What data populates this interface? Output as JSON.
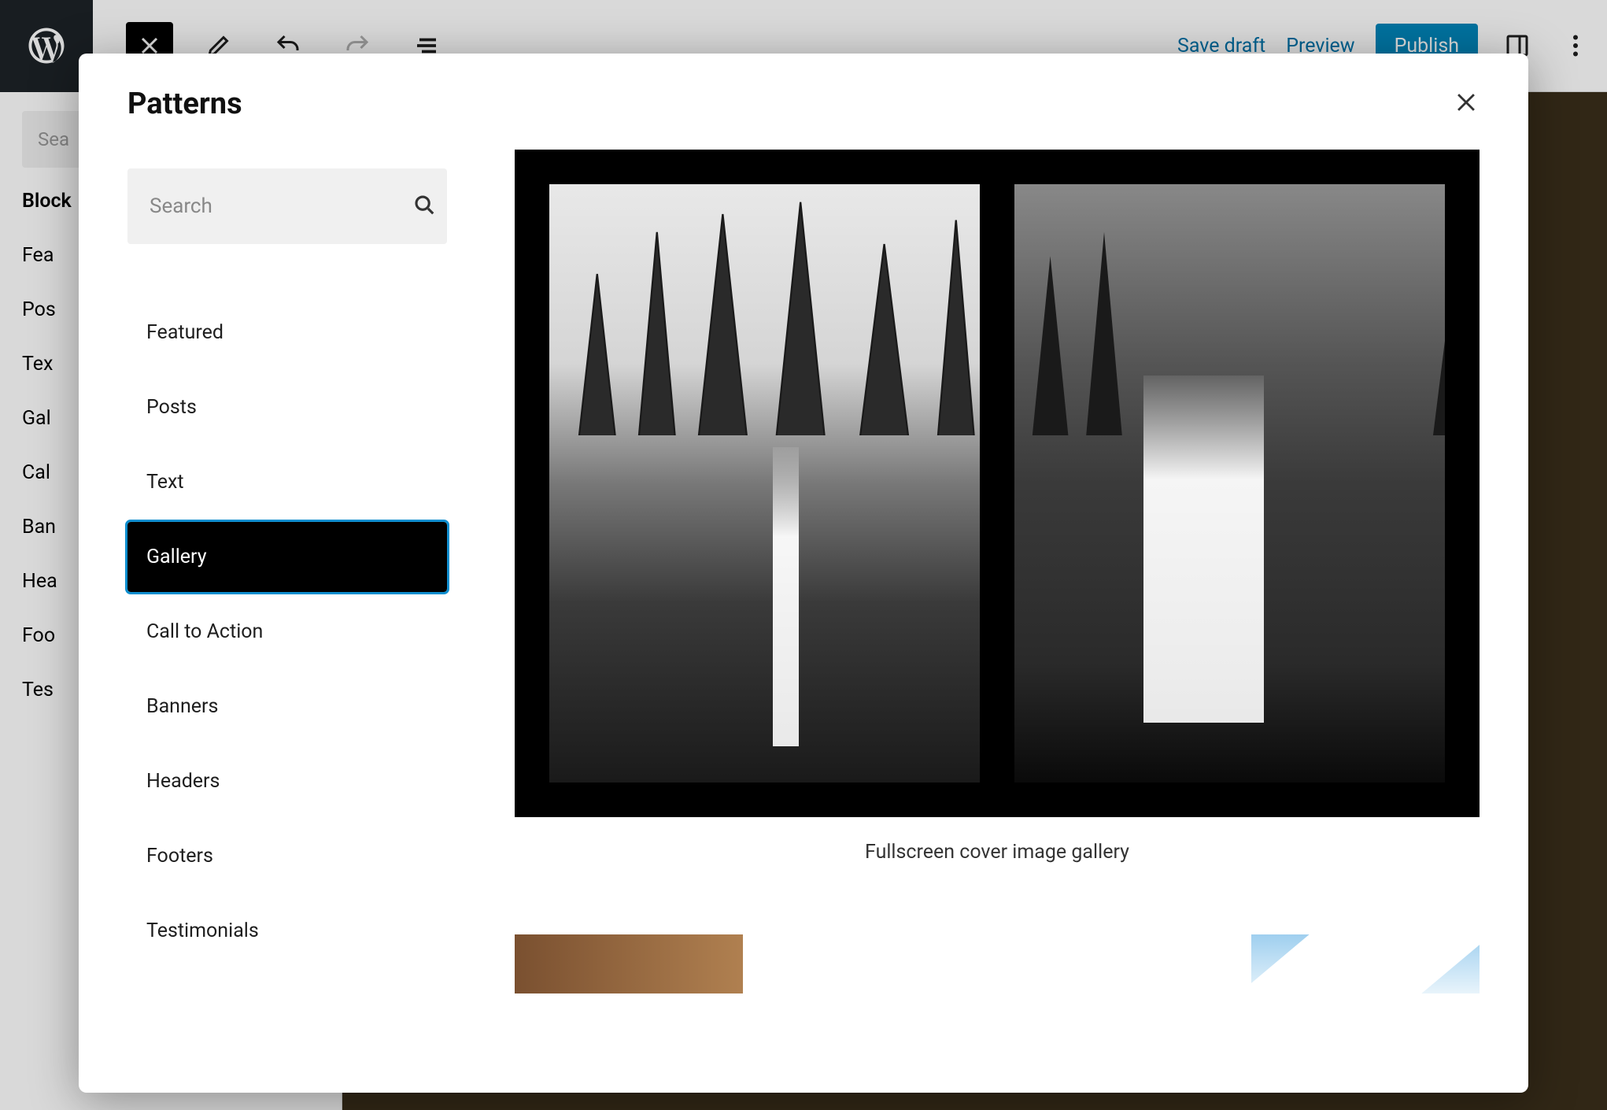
{
  "topbar": {
    "save_draft": "Save draft",
    "preview": "Preview",
    "publish": "Publish"
  },
  "bg_sidebar": {
    "search_placeholder": "Sea",
    "heading": "Block",
    "cats": [
      "Fea",
      "Pos",
      "Tex",
      "Gal",
      "Cal",
      "Ban",
      "Hea",
      "Foo",
      "Tes"
    ]
  },
  "modal": {
    "title": "Patterns",
    "search_placeholder": "Search",
    "categories": [
      {
        "label": "Featured",
        "active": false
      },
      {
        "label": "Posts",
        "active": false
      },
      {
        "label": "Text",
        "active": false
      },
      {
        "label": "Gallery",
        "active": true
      },
      {
        "label": "Call to Action",
        "active": false
      },
      {
        "label": "Banners",
        "active": false
      },
      {
        "label": "Headers",
        "active": false
      },
      {
        "label": "Footers",
        "active": false
      },
      {
        "label": "Testimonials",
        "active": false
      }
    ],
    "pattern_caption": "Fullscreen cover image gallery"
  }
}
